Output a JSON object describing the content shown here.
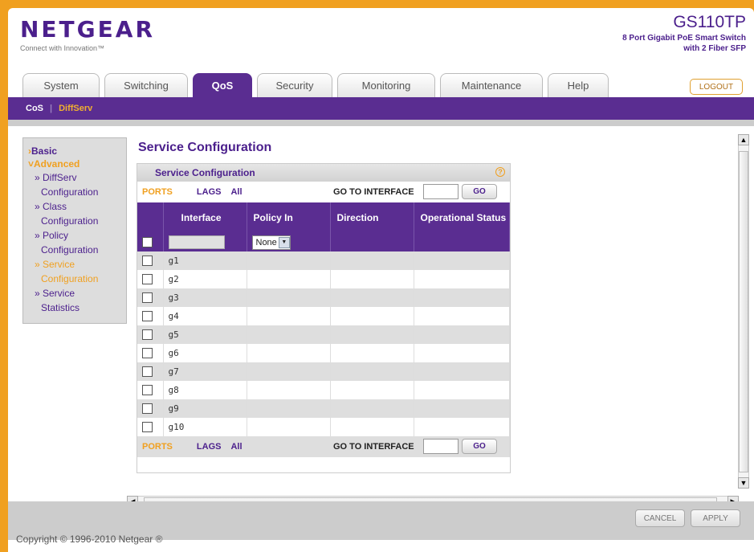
{
  "brand": {
    "logo": "NETGEAR",
    "tagline": "Connect with Innovation™"
  },
  "model": {
    "name": "GS110TP",
    "desc_line1": "8 Port Gigabit PoE Smart Switch",
    "desc_line2": "with 2 Fiber SFP"
  },
  "tabs": [
    {
      "label": "System"
    },
    {
      "label": "Switching"
    },
    {
      "label": "QoS",
      "active": true
    },
    {
      "label": "Security"
    },
    {
      "label": "Monitoring"
    },
    {
      "label": "Maintenance"
    },
    {
      "label": "Help"
    }
  ],
  "logout_label": "LOGOUT",
  "subnav": {
    "cos": "CoS",
    "diffserv": "DiffServ"
  },
  "leftnav": {
    "basic": "Basic",
    "advanced": "Advanced",
    "items": [
      {
        "line1": "» DiffServ",
        "line2": "Configuration"
      },
      {
        "line1": "» Class",
        "line2": "Configuration"
      },
      {
        "line1": "» Policy",
        "line2": "Configuration"
      },
      {
        "line1": "» Service",
        "line2": "Configuration",
        "active": true
      },
      {
        "line1": "» Service",
        "line2": "Statistics"
      }
    ]
  },
  "page_title": "Service Configuration",
  "panel": {
    "title": "Service Configuration",
    "help_icon": "question-icon",
    "toolbar": {
      "ports": "PORTS",
      "lags": "LAGS",
      "all": "All",
      "goto_label": "GO TO INTERFACE",
      "goto_value": "",
      "go_button": "GO"
    },
    "columns": [
      "Interface",
      "Policy In",
      "Direction",
      "Operational Status"
    ],
    "edit_row": {
      "interface_value": "",
      "policy_selected": "None"
    },
    "rows": [
      {
        "interface": "g1"
      },
      {
        "interface": "g2"
      },
      {
        "interface": "g3"
      },
      {
        "interface": "g4"
      },
      {
        "interface": "g5"
      },
      {
        "interface": "g6"
      },
      {
        "interface": "g7"
      },
      {
        "interface": "g8"
      },
      {
        "interface": "g9"
      },
      {
        "interface": "g10"
      }
    ]
  },
  "buttons": {
    "cancel": "CANCEL",
    "apply": "APPLY"
  },
  "copyright": "Copyright © 1996-2010 Netgear ®",
  "colors": {
    "purple": "#5a2d91",
    "orange": "#f0a020"
  }
}
